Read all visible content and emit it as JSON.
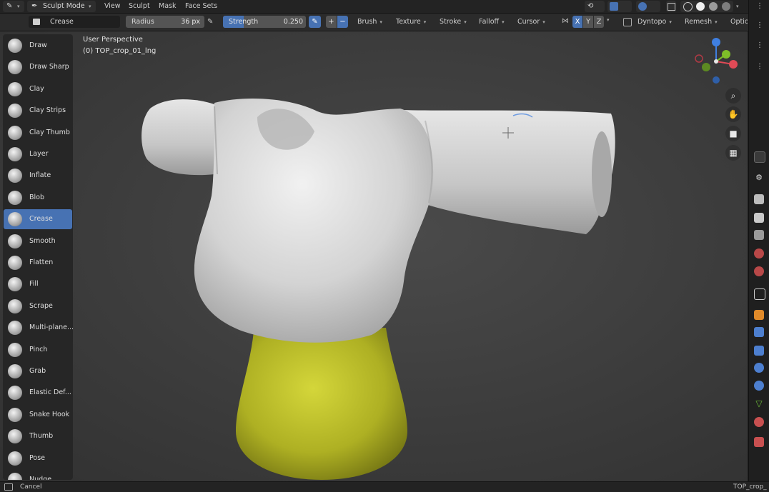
{
  "topbar": {
    "mode_label": "Sculpt Mode",
    "menus": [
      "View",
      "Sculpt",
      "Mask",
      "Face Sets"
    ]
  },
  "header": {
    "brush_name": "Crease",
    "radius_label": "Radius",
    "radius_value": "36 px",
    "strength_label": "Strength",
    "strength_value": "0.250",
    "strength_fraction": 0.25,
    "dropdowns": [
      "Brush",
      "Texture",
      "Stroke",
      "Falloff",
      "Cursor"
    ],
    "axes": [
      "X",
      "Y",
      "Z"
    ],
    "dyntopo_label": "Dyntopo",
    "remesh_label": "Remesh",
    "options_label": "Optio"
  },
  "viewport": {
    "title": "User Perspective",
    "object_name": "(0) TOP_crop_01_lng"
  },
  "tools": [
    {
      "label": "Draw",
      "active": false
    },
    {
      "label": "Draw Sharp",
      "active": false
    },
    {
      "label": "Clay",
      "active": false
    },
    {
      "label": "Clay Strips",
      "active": false
    },
    {
      "label": "Clay Thumb",
      "active": false
    },
    {
      "label": "Layer",
      "active": false
    },
    {
      "label": "Inflate",
      "active": false
    },
    {
      "label": "Blob",
      "active": false
    },
    {
      "label": "Crease",
      "active": true
    },
    {
      "label": "Smooth",
      "active": false
    },
    {
      "label": "Flatten",
      "active": false
    },
    {
      "label": "Fill",
      "active": false
    },
    {
      "label": "Scrape",
      "active": false
    },
    {
      "label": "Multi-plane...",
      "active": false
    },
    {
      "label": "Pinch",
      "active": false
    },
    {
      "label": "Grab",
      "active": false
    },
    {
      "label": "Elastic Def...",
      "active": false
    },
    {
      "label": "Snake Hook",
      "active": false
    },
    {
      "label": "Thumb",
      "active": false
    },
    {
      "label": "Pose",
      "active": false
    },
    {
      "label": "Nudge",
      "active": false
    }
  ],
  "statusbar": {
    "left": "Cancel",
    "right": "TOP_crop_"
  },
  "colors": {
    "active_tool": "#4772b3",
    "mesh_white": "#d9d9d9",
    "mesh_yellow": "#b9bd2a",
    "axis_x": "#e04a56",
    "axis_y": "#7fbf28",
    "axis_z": "#3f7fe0"
  }
}
